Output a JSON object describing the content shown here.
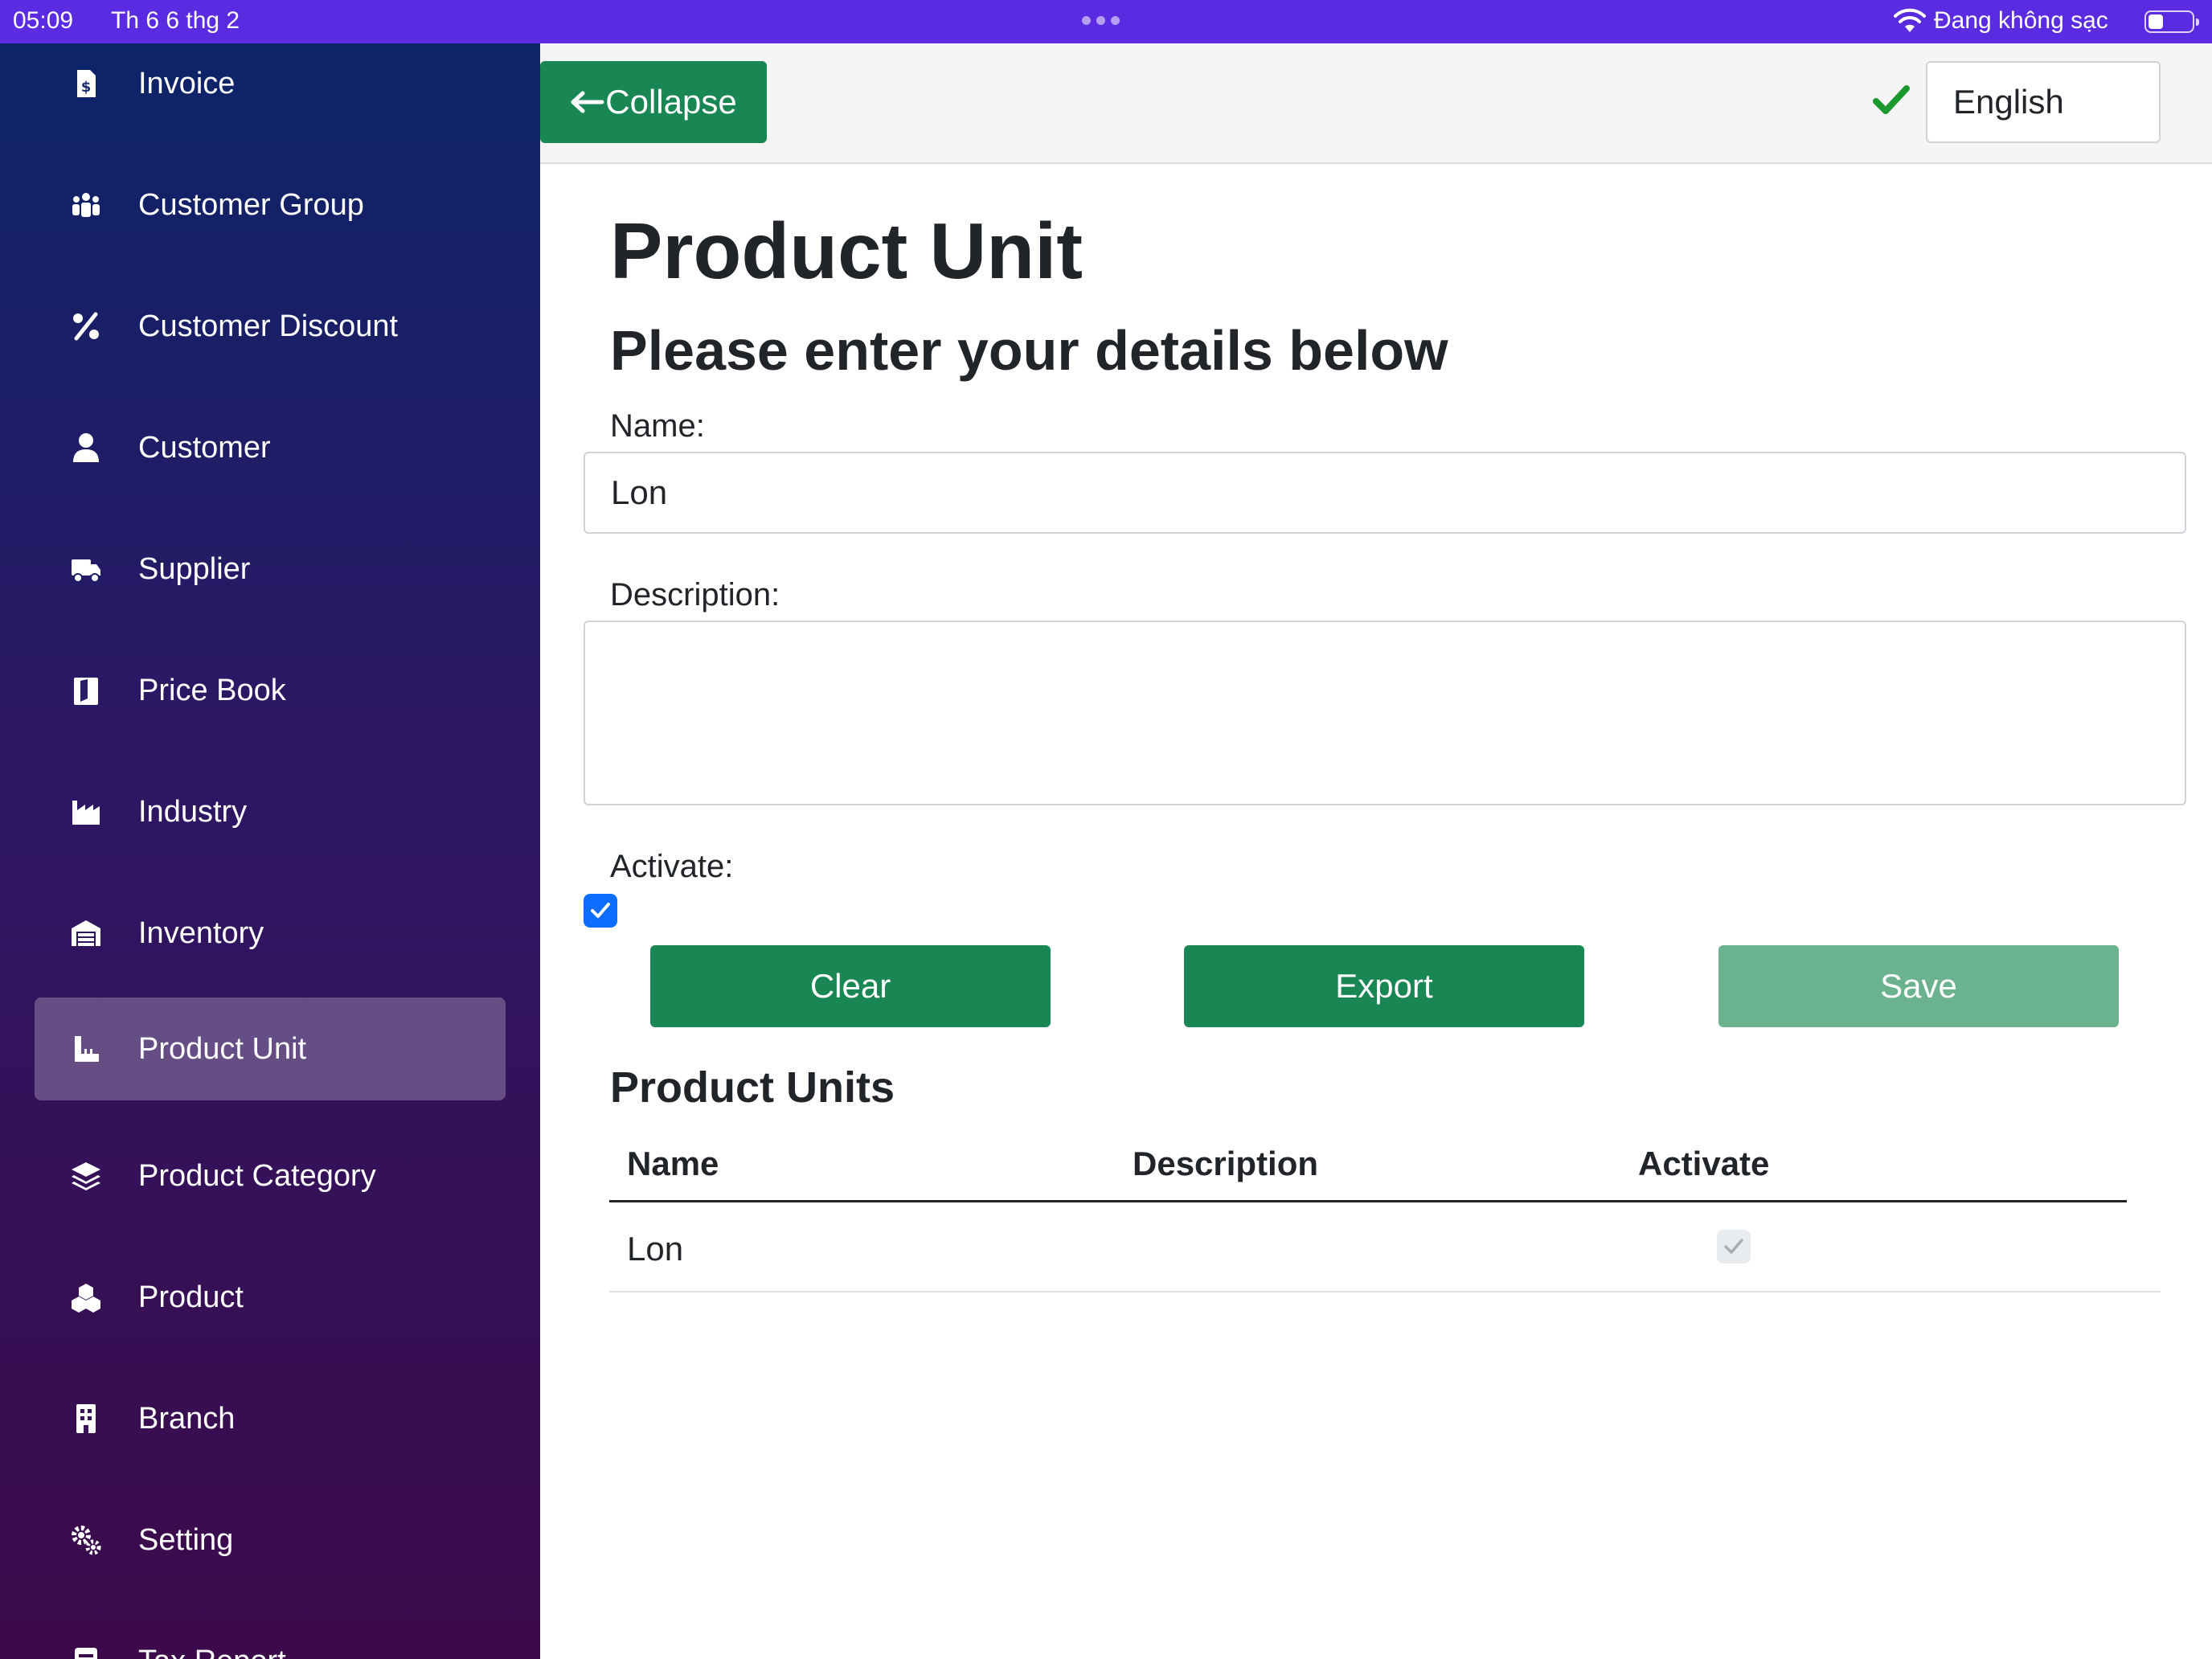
{
  "status_bar": {
    "time": "05:09",
    "date": "Th 6 6 thg 2",
    "charging": "Đang không sạc"
  },
  "sidebar": {
    "items": [
      {
        "label": "Invoice",
        "icon": "invoice-icon"
      },
      {
        "label": "Customer Group",
        "icon": "users-icon"
      },
      {
        "label": "Customer Discount",
        "icon": "percent-icon"
      },
      {
        "label": "Customer",
        "icon": "user-icon"
      },
      {
        "label": "Supplier",
        "icon": "truck-icon"
      },
      {
        "label": "Price Book",
        "icon": "book-icon"
      },
      {
        "label": "Industry",
        "icon": "industry-icon"
      },
      {
        "label": "Inventory",
        "icon": "warehouse-icon"
      },
      {
        "label": "Product Unit",
        "icon": "ruler-icon",
        "active": true
      },
      {
        "label": "Product Category",
        "icon": "layers-icon"
      },
      {
        "label": "Product",
        "icon": "cubes-icon"
      },
      {
        "label": "Branch",
        "icon": "building-icon"
      },
      {
        "label": "Setting",
        "icon": "gears-icon"
      },
      {
        "label": "Tax Report",
        "icon": "report-icon"
      }
    ]
  },
  "topbar": {
    "collapse_label": "Collapse",
    "language": "English"
  },
  "form": {
    "title": "Product Unit",
    "subtitle": "Please enter your details below",
    "name_label": "Name:",
    "name_value": "Lon",
    "description_label": "Description:",
    "description_value": "",
    "activate_label": "Activate:",
    "activate_checked": true
  },
  "buttons": {
    "clear": "Clear",
    "export": "Export",
    "save": "Save"
  },
  "table": {
    "title": "Product Units",
    "columns": [
      "Name",
      "Description",
      "Activate"
    ],
    "rows": [
      {
        "name": "Lon",
        "description": "",
        "activate": true
      }
    ]
  },
  "colors": {
    "primary_green": "#198754",
    "disabled_green": "#6bb28f",
    "status_bar": "#5a2be0",
    "checkbox_blue": "#0d6efd"
  }
}
